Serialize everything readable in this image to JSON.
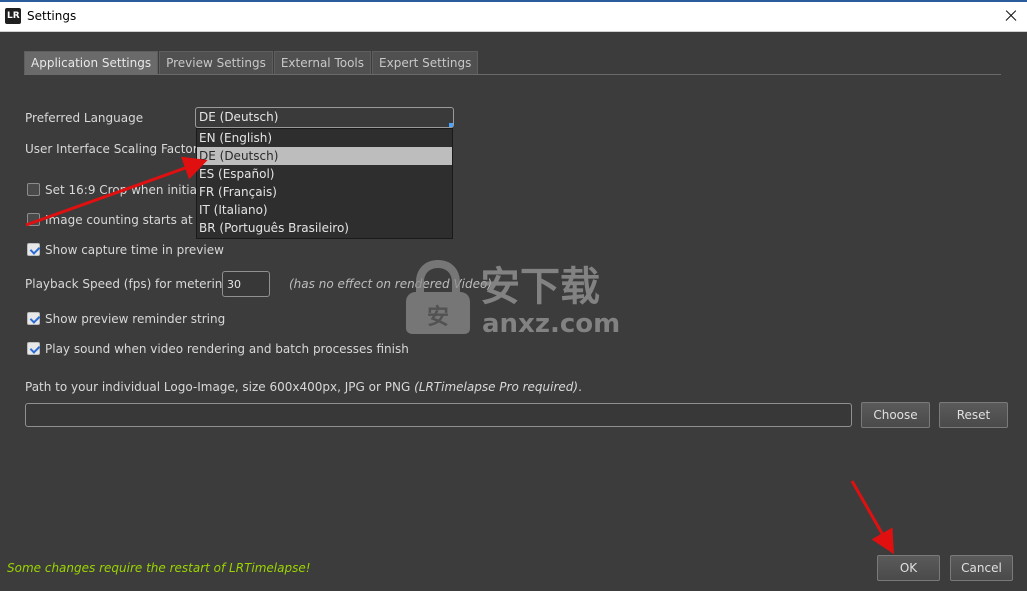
{
  "window": {
    "title": "Settings",
    "app_icon_letters": "LR"
  },
  "tabs": [
    {
      "label": "Application Settings",
      "active": true
    },
    {
      "label": "Preview Settings",
      "active": false
    },
    {
      "label": "External Tools",
      "active": false
    },
    {
      "label": "Expert Settings",
      "active": false
    }
  ],
  "settings": {
    "preferred_language": {
      "label": "Preferred Language",
      "value": "DE (Deutsch)",
      "options": [
        "EN (English)",
        "DE (Deutsch)",
        "ES (Español)",
        "FR (Français)",
        "IT (Italiano)",
        "BR (Português Brasileiro)"
      ],
      "selected_index": 1
    },
    "scaling_factor": {
      "label": "User Interface Scaling Factor"
    },
    "crop_16_9": {
      "label": "Set 16:9 Crop when initializi",
      "checked": false
    },
    "image_counting": {
      "label": "Image counting starts at 1 (",
      "checked": false
    },
    "show_capture_time": {
      "label": "Show capture time in preview",
      "checked": true
    },
    "playback_speed": {
      "label": "Playback Speed (fps) for metering",
      "value": "30",
      "note": "(has no effect on rendered Video)"
    },
    "show_reminder": {
      "label": "Show preview reminder string",
      "checked": true
    },
    "play_sound": {
      "label": "Play sound when video rendering and batch processes finish",
      "checked": true
    },
    "logo_path": {
      "label": "Path to your individual Logo-Image, size 600x400px, JPG or PNG ",
      "label_note": "(LRTimelapse Pro required)",
      "label_end": ".",
      "value": "",
      "choose_label": "Choose",
      "reset_label": "Reset"
    }
  },
  "footer": {
    "restart_note": "Some changes require the restart of LRTimelapse!",
    "ok_label": "OK",
    "cancel_label": "Cancel"
  },
  "watermark": {
    "logo_text": "安下载",
    "sub_text": "anxz.com"
  },
  "colors": {
    "accent_green": "#9bd400",
    "annotation_red": "#e01010",
    "checkbox_blue": "#2b6cd4",
    "title_accent": "#2a5c9e"
  }
}
